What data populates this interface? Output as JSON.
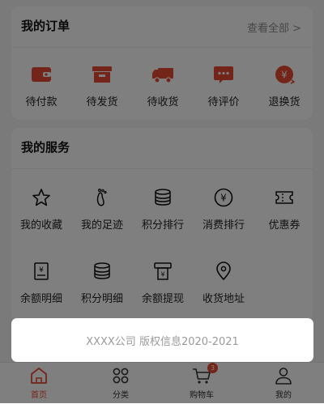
{
  "orders": {
    "title": "我的订单",
    "view_all": "查看全部 >",
    "items": [
      {
        "label": "待付款",
        "icon": "wallet-icon"
      },
      {
        "label": "待发货",
        "icon": "box-icon"
      },
      {
        "label": "待收货",
        "icon": "truck-icon"
      },
      {
        "label": "待评价",
        "icon": "chat-icon"
      },
      {
        "label": "退换货",
        "icon": "refund-icon"
      }
    ]
  },
  "services": {
    "title": "我的服务",
    "items": [
      {
        "label": "我的收藏",
        "icon": "star-icon"
      },
      {
        "label": "我的足迹",
        "icon": "footprint-icon"
      },
      {
        "label": "积分排行",
        "icon": "coins-icon"
      },
      {
        "label": "消费排行",
        "icon": "yen-circle-icon"
      },
      {
        "label": "优惠券",
        "icon": "coupon-icon"
      },
      {
        "label": "余额明细",
        "icon": "receipt-icon"
      },
      {
        "label": "积分明细",
        "icon": "coins-icon"
      },
      {
        "label": "余额提现",
        "icon": "withdraw-icon"
      },
      {
        "label": "收货地址",
        "icon": "location-pin-icon"
      }
    ]
  },
  "toast": {
    "text": "XXXX公司 版权信息2020-2021"
  },
  "tabbar": {
    "items": [
      {
        "label": "首页",
        "icon": "home-icon",
        "active": true
      },
      {
        "label": "分类",
        "icon": "grid-icon",
        "active": false
      },
      {
        "label": "购物车",
        "icon": "cart-icon",
        "active": false,
        "badge": "3"
      },
      {
        "label": "我的",
        "icon": "user-icon",
        "active": false
      }
    ]
  },
  "colors": {
    "accent": "#e84a33",
    "overlay": "rgba(0,0,0,0.5)"
  }
}
